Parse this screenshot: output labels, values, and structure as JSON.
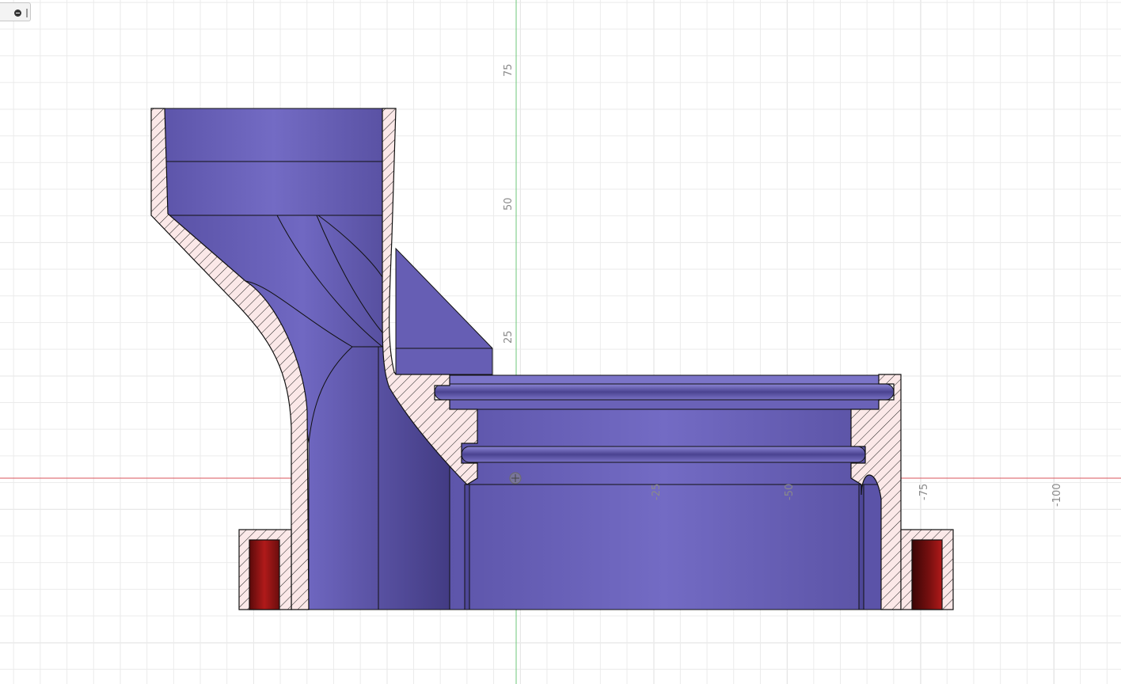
{
  "viewport": {
    "axis_labels": {
      "y_75": "75",
      "y_50": "50",
      "y_25": "25",
      "x_neg25": "-25",
      "x_neg50": "-50",
      "x_neg75": "-75",
      "x_neg100": "-100"
    },
    "axis_colors": {
      "x_axis": "#d9535b",
      "y_axis": "#6cc77a"
    }
  },
  "model": {
    "body_color": "#6c63b8",
    "section_fill_color": "#fbe8e8",
    "insert_color": "#8a1414"
  },
  "toolbar": {
    "icon": "visibility-toggle-icon"
  }
}
